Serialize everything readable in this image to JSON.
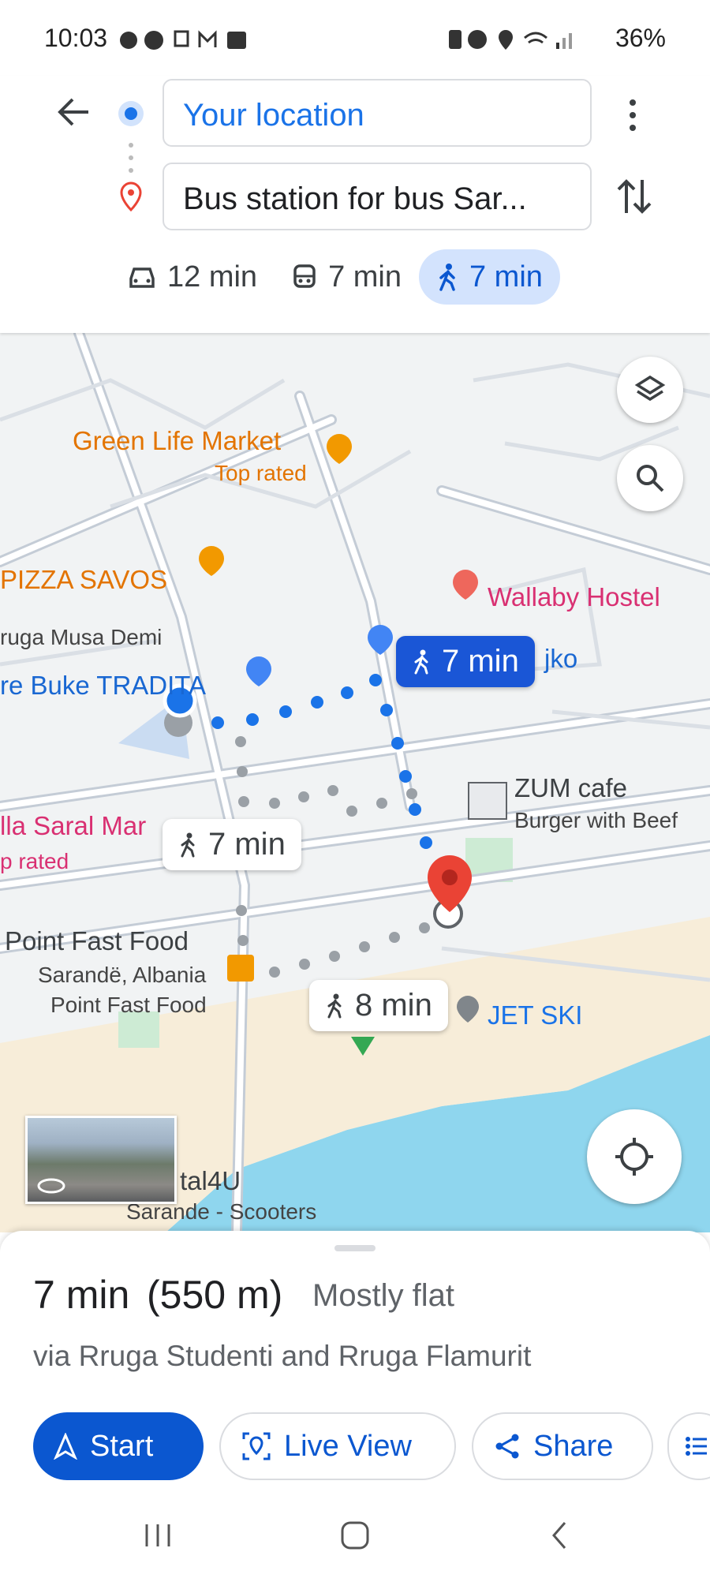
{
  "status_bar": {
    "time": "10:03",
    "battery": "36%"
  },
  "directions": {
    "from": "Your location",
    "to": "Bus station for bus Sar...",
    "modes": [
      {
        "icon": "car-icon",
        "label": "12 min"
      },
      {
        "icon": "transit-icon",
        "label": "7 min"
      },
      {
        "icon": "walk-icon",
        "label": "7 min"
      }
    ]
  },
  "map": {
    "pois": {
      "green_life": "Green Life Market",
      "green_life_sub": "Top rated",
      "pizza": "PIZZA SAVOS",
      "musa_demi": "ruga Musa Demi",
      "tradita": "re Buke TRADITA",
      "wallaby": "Wallaby Hostel",
      "jko": "jko",
      "zum": "ZUM cafe",
      "zum_sub": "Burger with Beef",
      "saral": "lla Saral Mar",
      "saral_sub": "p rated",
      "point": "Point Fast Food",
      "sarande": "Sarandë, Albania",
      "point_sub": "Point Fast Food",
      "jetski": "JET SKI",
      "tal4u": "tal4U",
      "scooters": "Sarande - Scooters"
    },
    "routes": {
      "selected": "7 min",
      "alt1": "7 min",
      "alt2": "8 min"
    }
  },
  "summary": {
    "time": "7 min",
    "distance": "(550 m)",
    "terrain": "Mostly flat",
    "via": "via Rruga Studenti and Rruga Flamurit"
  },
  "actions": {
    "start": "Start",
    "live_view": "Live View",
    "share": "Share"
  },
  "colors": {
    "accent": "#0b57d0",
    "route": "#4285f4",
    "destination": "#ea4335",
    "water": "#8fd6ee"
  }
}
